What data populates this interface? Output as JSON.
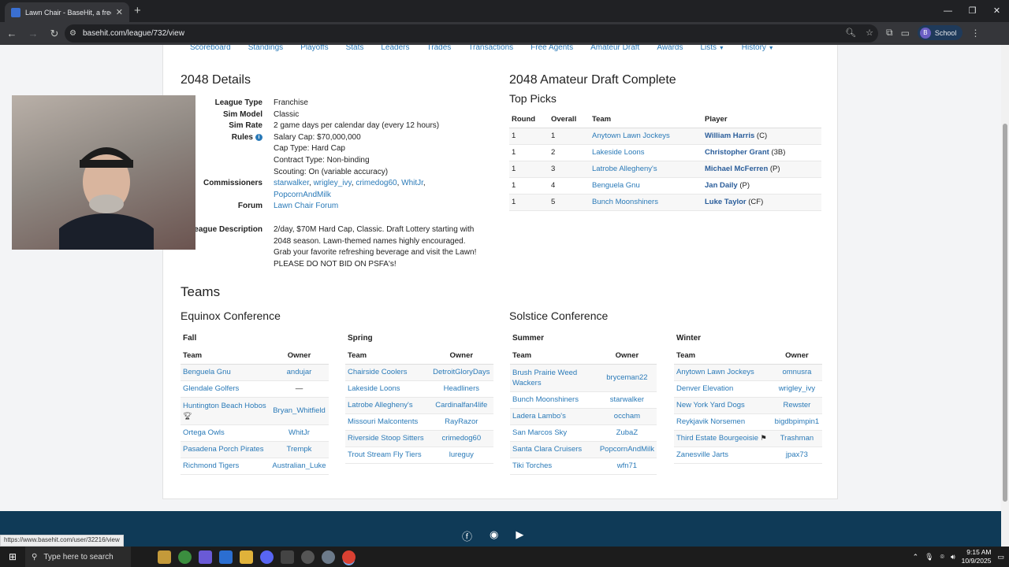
{
  "browser": {
    "tab_title": "Lawn Chair - BaseHit, a free sim...",
    "new_tab": "+",
    "url": "basehit.com/league/732/view",
    "profile_label": "School",
    "profile_initial": "B",
    "status_url": "https://www.basehit.com/user/32216/view"
  },
  "nav": [
    "Scoreboard",
    "Standings",
    "Playoffs",
    "Stats",
    "Leaders",
    "Trades",
    "Transactions",
    "Free Agents",
    "Amateur Draft",
    "Awards",
    "Lists",
    "History"
  ],
  "details": {
    "heading": "2048 Details",
    "rows": [
      {
        "label": "League Type",
        "value": "Franchise"
      },
      {
        "label": "Sim Model",
        "value": "Classic"
      },
      {
        "label": "Sim Rate",
        "value": "2 game days per calendar day (every 12 hours)"
      },
      {
        "label": "Rules",
        "lines": [
          "Salary Cap: $70,000,000",
          "Cap Type: Hard Cap",
          "Contract Type: Non-binding",
          "Scouting: On (variable accuracy)"
        ]
      },
      {
        "label": "Commissioners",
        "links": [
          "starwalker",
          "wrigley_ivy",
          "crimedog60",
          "WhitJr",
          "PopcornAndMilk"
        ]
      },
      {
        "label": "Forum",
        "link": "Lawn Chair Forum"
      },
      {
        "label": "League Description",
        "value": "2/day, $70M Hard Cap, Classic. Draft Lottery starting with 2048 season. Lawn-themed names highly encouraged. Grab your favorite refreshing beverage and visit the Lawn! PLEASE DO NOT BID ON PSFA's!"
      }
    ]
  },
  "draft": {
    "heading": "2048 Amateur Draft Complete",
    "subheading": "Top Picks",
    "columns": [
      "Round",
      "Overall",
      "Team",
      "Player"
    ],
    "rows": [
      {
        "round": "1",
        "overall": "1",
        "team": "Anytown Lawn Jockeys",
        "player": "William Harris",
        "pos": "(C)"
      },
      {
        "round": "1",
        "overall": "2",
        "team": "Lakeside Loons",
        "player": "Christopher Grant",
        "pos": "(3B)"
      },
      {
        "round": "1",
        "overall": "3",
        "team": "Latrobe Allegheny's",
        "player": "Michael McFerren",
        "pos": "(P)"
      },
      {
        "round": "1",
        "overall": "4",
        "team": "Benguela Gnu",
        "player": "Jan Daily",
        "pos": "(P)"
      },
      {
        "round": "1",
        "overall": "5",
        "team": "Bunch Moonshiners",
        "player": "Luke Taylor",
        "pos": "(CF)"
      }
    ]
  },
  "teams": {
    "heading": "Teams",
    "team_col": "Team",
    "owner_col": "Owner",
    "conferences": [
      {
        "name": "Equinox Conference",
        "divisions": [
          {
            "name": "Fall",
            "rows": [
              {
                "team": "Benguela Gnu",
                "owner": "andujar"
              },
              {
                "team": "Glendale Golfers",
                "owner": "—"
              },
              {
                "team": "Huntington Beach Hobos",
                "owner": "Bryan_Whitfield"
              },
              {
                "team": "Ortega Owls",
                "owner": "WhitJr"
              },
              {
                "team": "Pasadena Porch Pirates",
                "owner": "Trempk"
              },
              {
                "team": "Richmond Tigers",
                "owner": "Australian_Luke"
              }
            ]
          },
          {
            "name": "Spring",
            "rows": [
              {
                "team": "Chairside Coolers",
                "owner": "DetroitGloryDays"
              },
              {
                "team": "Lakeside Loons",
                "owner": "Headliners"
              },
              {
                "team": "Latrobe Allegheny's",
                "owner": "Cardinalfan4life"
              },
              {
                "team": "Missouri Malcontents",
                "owner": "RayRazor"
              },
              {
                "team": "Riverside Stoop Sitters",
                "owner": "crimedog60"
              },
              {
                "team": "Trout Stream Fly Tiers",
                "owner": "lureguy"
              }
            ]
          }
        ]
      },
      {
        "name": "Solstice Conference",
        "divisions": [
          {
            "name": "Summer",
            "rows": [
              {
                "team": "Brush Prairie Weed Wackers",
                "owner": "bryceman22"
              },
              {
                "team": "Bunch Moonshiners",
                "owner": "starwalker"
              },
              {
                "team": "Ladera Lambo's",
                "owner": "occham"
              },
              {
                "team": "San Marcos Sky",
                "owner": "ZubaZ"
              },
              {
                "team": "Santa Clara Cruisers",
                "owner": "PopcornAndMilk"
              },
              {
                "team": "Tiki Torches",
                "owner": "wfn71"
              }
            ]
          },
          {
            "name": "Winter",
            "rows": [
              {
                "team": "Anytown Lawn Jockeys",
                "owner": "omnusra"
              },
              {
                "team": "Denver Elevation",
                "owner": "wrigley_ivy"
              },
              {
                "team": "New York Yard Dogs",
                "owner": "Rewster"
              },
              {
                "team": "Reykjavik Norsemen",
                "owner": "bigdbpimpin1"
              },
              {
                "team": "Third Estate Bourgeoisie",
                "owner": "Trashman"
              },
              {
                "team": "Zanesville Jarts",
                "owner": "jpax73"
              }
            ]
          }
        ]
      }
    ]
  },
  "taskbar": {
    "search_placeholder": "Type here to search",
    "time": "9:15 AM",
    "date": "10/9/2025"
  },
  "colors": {
    "link": "#2a7ab8",
    "footer": "#0f3a57",
    "chrome_dark": "#202124"
  }
}
